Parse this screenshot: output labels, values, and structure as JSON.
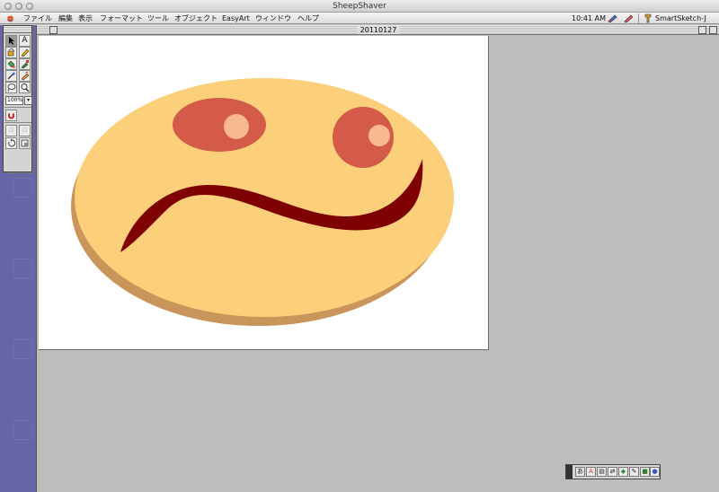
{
  "host": {
    "title": "SheepShaver"
  },
  "menubar": {
    "items": [
      "ファイル",
      "編集",
      "表示",
      "フォーマット",
      "ツール",
      "オブジェクト",
      "EasyArt",
      "ウィンドウ",
      "ヘルプ"
    ],
    "clock": "10:41 AM",
    "app_name": "SmartSketch-J"
  },
  "document": {
    "title": "20110127"
  },
  "tools": {
    "zoom": "100%",
    "text_tool_glyph": "A"
  },
  "drawing": {
    "face_fill": "#fcd07a",
    "face_shadow": "#c9955a",
    "eye_fill": "#d45a4a",
    "eye_highlight": "#f9b98f",
    "mouth_fill": "#7f0000"
  },
  "floatbar": {
    "labels": [
      "あ",
      "A"
    ]
  }
}
